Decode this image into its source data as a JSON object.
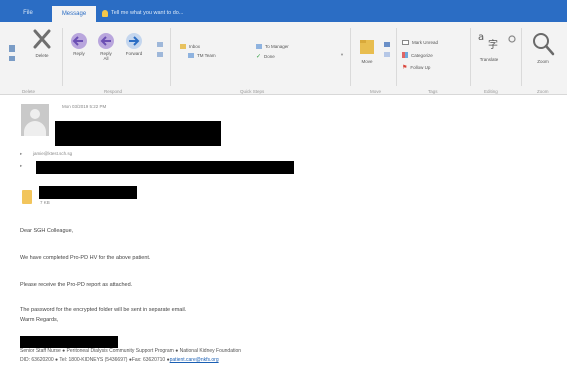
{
  "tabs": {
    "file": "File",
    "message": "Message",
    "tellme": "Tell me what you want to do..."
  },
  "ribbon": {
    "delete_group": {
      "delete": "Delete",
      "label": "Delete"
    },
    "respond_group": {
      "reply": "Reply",
      "reply_all": "Reply\nAll",
      "forward": "Forward",
      "label": "Respond"
    },
    "quick_steps": {
      "inbox": "Inbox",
      "team": "TM Team",
      "to_manager": "To Manager",
      "done": "Done",
      "label": "Quick Steps"
    },
    "move_group": {
      "move": "Move",
      "label": "Move"
    },
    "tags_group": {
      "mark_unread": "Mark Unread",
      "categorize": "Categorize",
      "follow_up": "Follow Up",
      "label": "Tags"
    },
    "editing_group": {
      "translate": "Translate",
      "label": "Editing"
    },
    "zoom_group": {
      "zoom": "Zoom",
      "label": "Zoom"
    }
  },
  "header": {
    "sent_time": "Mon 03/2019 5:22 PM",
    "to_label": "jamie@ktest.sch.sg"
  },
  "attachment": {
    "size": "7 KB"
  },
  "body": {
    "greeting": "Dear SGH Colleague,",
    "line1": "We have completed Pro-PD HV for the above patient.",
    "line2": "Please receive the Pro-PD report as attached.",
    "line3": "The password for the encrypted folder will be sent in separate email.",
    "regards": "Warm Regards,"
  },
  "signature": {
    "line1": "Senior Staff Nurse ● Peritoneal Dialysis Community Support Program ● National Kidney Foundation",
    "line2_prefix": "DID: 63620200 ● Tel: 1800-KIDNEYS (5436697) ●Fax: 63620710 ●",
    "email": "patient.care@nkfs.org"
  },
  "colors": {
    "accent": "#2b6dc4",
    "ribbon_bg": "#f3f3f3"
  }
}
